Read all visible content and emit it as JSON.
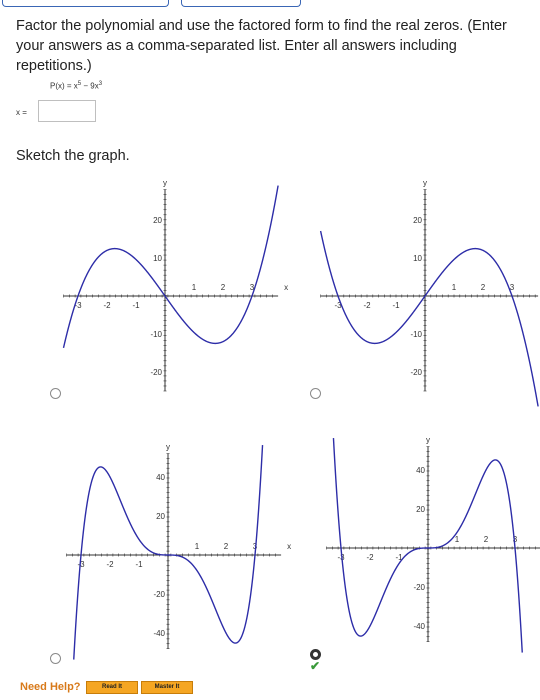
{
  "question": {
    "text": "Factor the polynomial and use the factored form to find the real zeros. (Enter your answers as a comma-separated list. Enter all answers including repetitions.)",
    "polynomial_lhs": "P(x) = x",
    "polynomial_exp1": "5",
    "polynomial_mid": " − 9x",
    "polynomial_exp2": "3",
    "answer_label": "x =",
    "answer_value": ""
  },
  "sketch_label": "Sketch the graph.",
  "graphs": [
    {
      "id": "a",
      "y_label": "y",
      "x_label": "x",
      "x_ticks": [
        "-3",
        "-2",
        "-1",
        "1",
        "2",
        "3"
      ],
      "y_ticks": [
        "20",
        "10",
        "-10",
        "-20"
      ],
      "selected": false
    },
    {
      "id": "b",
      "y_label": "y",
      "x_ticks": [
        "-3",
        "-2",
        "-1",
        "1",
        "2",
        "3"
      ],
      "y_ticks": [
        "20",
        "10",
        "-10",
        "-20"
      ],
      "selected": false
    },
    {
      "id": "c",
      "y_label": "y",
      "x_label": "x",
      "x_ticks": [
        "-3",
        "-2",
        "-1",
        "1",
        "2",
        "3"
      ],
      "y_ticks": [
        "40",
        "20",
        "-20",
        "-40"
      ],
      "selected": false
    },
    {
      "id": "d",
      "y_label": "y",
      "x_ticks": [
        "-3",
        "-2",
        "-1",
        "1",
        "2",
        "3"
      ],
      "y_ticks": [
        "40",
        "20",
        "-20",
        "-40"
      ],
      "selected": true
    }
  ],
  "help": {
    "label": "Need Help?",
    "read_it": "Read It",
    "master_it": "Master It"
  },
  "colors": {
    "curve": "#2d2da8",
    "axis": "#333333",
    "accent": "#f5a623"
  }
}
